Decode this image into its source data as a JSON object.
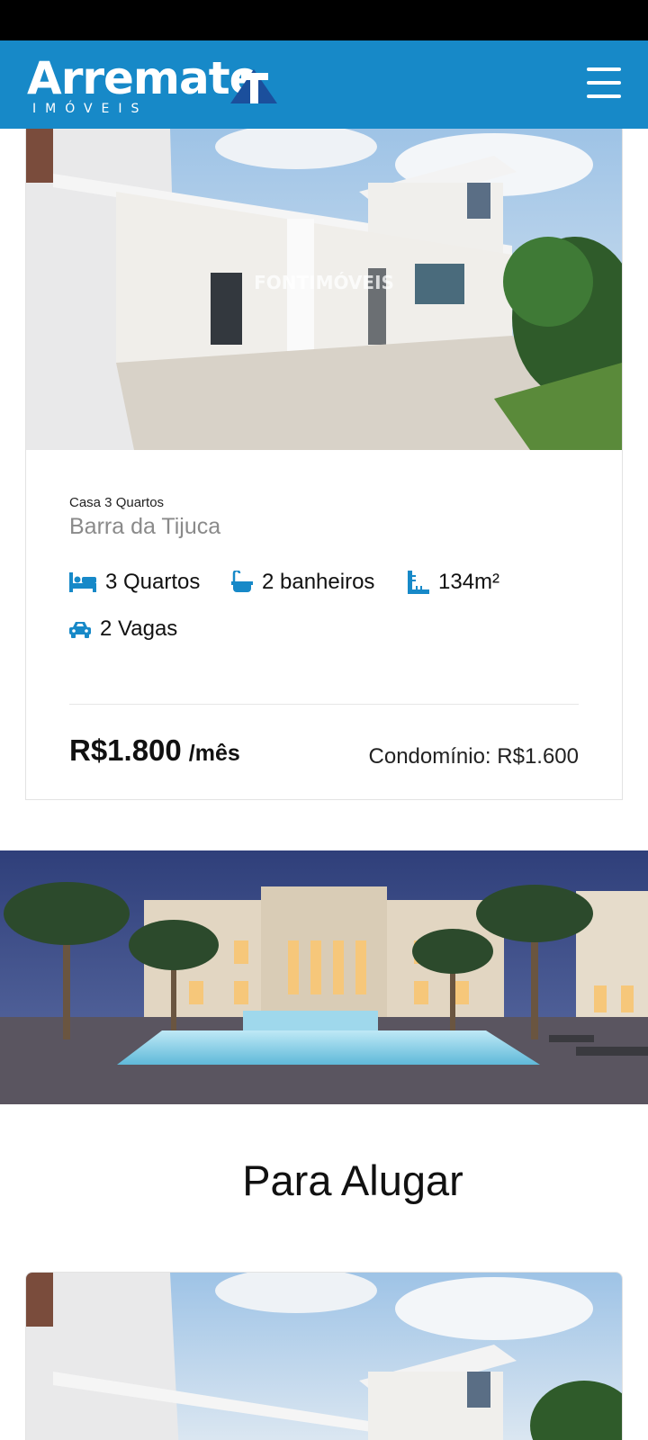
{
  "header": {
    "logo_text": "Arremate",
    "logo_subtitle": "IMÓVEIS",
    "menu_icon": "hamburger-menu-icon"
  },
  "listing": {
    "watermark": "FONTIMÓVEIS",
    "type": "Casa 3 Quartos",
    "neighborhood": "Barra da Tijuca",
    "features": [
      {
        "icon": "bed-icon",
        "label": "3 Quartos"
      },
      {
        "icon": "bathtub-icon",
        "label": "2 banheiros"
      },
      {
        "icon": "ruler-icon",
        "label": "134m²"
      },
      {
        "icon": "car-icon",
        "label": "2 Vagas"
      }
    ],
    "price": "R$1.800",
    "price_period": "/mês",
    "condo_fee": "Condomínio: R$1.600"
  },
  "section": {
    "title": "Para Alugar"
  },
  "colors": {
    "brand_blue": "#1789c8",
    "icon_blue": "#1789c8",
    "text_dark": "#111111",
    "text_muted": "#8a8a8a"
  }
}
